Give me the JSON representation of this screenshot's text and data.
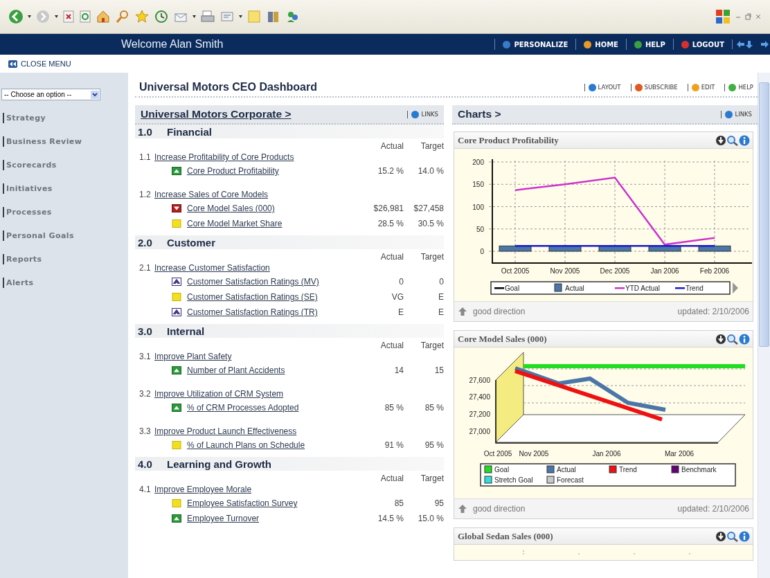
{
  "header": {
    "welcome": "Welcome Alan Smith",
    "nav": [
      {
        "label": "PERSONALIZE",
        "color": "#3a7ac8"
      },
      {
        "label": "HOME",
        "color": "#e89a28"
      },
      {
        "label": "HELP",
        "color": "#3aa040"
      },
      {
        "label": "LOGOUT",
        "color": "#d83030"
      }
    ]
  },
  "close_menu": "CLOSE MENU",
  "sidebar": {
    "select": {
      "value": "-- Choose an option --"
    },
    "items": [
      "Strategy",
      "Business Review",
      "Scorecards",
      "Initiatives",
      "Processes",
      "Personal Goals",
      "Reports",
      "Alerts"
    ]
  },
  "dashboard": {
    "title": "Universal Motors CEO Dashboard",
    "actions": [
      {
        "label": "LAYOUT",
        "color": "#2a7ad0"
      },
      {
        "label": "SUBSCRIBE",
        "color": "#e05a20"
      },
      {
        "label": "EDIT",
        "color": "#f0a020"
      },
      {
        "label": "HELP",
        "color": "#40b040"
      }
    ]
  },
  "scorecard": {
    "title": "Universal Motors Corporate >",
    "links": "LINKS",
    "sections": [
      {
        "number": "1.0",
        "title": "Financial",
        "columns": [
          "Actual",
          "Target"
        ],
        "objectives": [
          {
            "number": "1.1",
            "title": "Increase Profitability of Core Products",
            "measures": [
              {
                "kind": "good",
                "name": "Core Product Profitability",
                "actual": "15.2 %",
                "target": "14.0 %"
              }
            ]
          },
          {
            "number": "1.2",
            "title": "Increase Sales of Core Models",
            "measures": [
              {
                "kind": "bad",
                "name": "Core Model Sales (000)",
                "actual": "$26,981",
                "target": "$27,458"
              },
              {
                "kind": "warning",
                "name": "Core Model Market Share",
                "actual": "28.5 %",
                "target": "30.5 %"
              }
            ]
          }
        ]
      },
      {
        "number": "2.0",
        "title": "Customer",
        "columns": [
          "Actual",
          "Target"
        ],
        "objectives": [
          {
            "number": "2.1",
            "title": "Increase Customer Satisfaction",
            "measures": [
              {
                "kind": "unchanged",
                "name": "Customer Satisfaction Ratings (MV)",
                "actual": "0",
                "target": "0"
              },
              {
                "kind": "warning",
                "name": "Customer Satisfaction Ratings (SE)",
                "actual": "VG",
                "target": "E"
              },
              {
                "kind": "unchanged",
                "name": "Customer Satisfaction Ratings (TR)",
                "actual": "E",
                "target": "E"
              }
            ]
          }
        ]
      },
      {
        "number": "3.0",
        "title": "Internal",
        "columns": [
          "Actual",
          "Target"
        ],
        "objectives": [
          {
            "number": "3.1",
            "title": "Improve Plant Safety",
            "measures": [
              {
                "kind": "good",
                "name": "Number of Plant Accidents",
                "actual": "14",
                "target": "15"
              }
            ]
          },
          {
            "number": "3.2",
            "title": "Improve Utilization of CRM System",
            "measures": [
              {
                "kind": "good",
                "name": "% of CRM Processes Adopted",
                "actual": "85 %",
                "target": "85 %"
              }
            ]
          },
          {
            "number": "3.3",
            "title": "Improve Product Launch Effectiveness",
            "measures": [
              {
                "kind": "warning",
                "name": "% of Launch Plans on Schedule",
                "actual": "91 %",
                "target": "95 %"
              }
            ]
          }
        ]
      },
      {
        "number": "4.0",
        "title": "Learning and Growth",
        "columns": [
          "Actual",
          "Target"
        ],
        "objectives": [
          {
            "number": "4.1",
            "title": "Improve Employee Morale",
            "measures": [
              {
                "kind": "warning",
                "name": "Employee Satisfaction Survey",
                "actual": "85",
                "target": "95"
              },
              {
                "kind": "good",
                "name": "Employee Turnover",
                "actual": "14.5 %",
                "target": "15.0 %"
              }
            ]
          }
        ]
      }
    ]
  },
  "charts_panel": {
    "title": "Charts >",
    "links": "LINKS",
    "cards": [
      {
        "title": "Core Product Profitability",
        "kind": "combo",
        "direction": "good direction",
        "updated": "updated: 2/10/2006",
        "chart_data": {
          "type": "line",
          "grid": true,
          "legend": "bottom",
          "categories": [
            "Oct 2005",
            "Nov 2005",
            "Dec 2005",
            "Jan 2006",
            "Feb 2006"
          ],
          "ylim": [
            0,
            200
          ],
          "yticks": [
            0,
            50,
            100,
            150,
            200
          ],
          "series": [
            {
              "name": "Goal",
              "color": "#000000",
              "type": "line",
              "values": [
                null,
                null,
                null,
                null,
                null
              ]
            },
            {
              "name": "Actual",
              "color": "#4a76a8",
              "type": "bar",
              "values": [
                12,
                12,
                12,
                12,
                12
              ]
            },
            {
              "name": "YTD Actual",
              "color": "#cc33cc",
              "type": "line",
              "values": [
                137,
                150,
                165,
                15,
                30
              ]
            },
            {
              "name": "Trend",
              "color": "#1a1acc",
              "type": "line",
              "values": [
                12,
                12,
                12,
                12,
                12
              ]
            }
          ]
        }
      },
      {
        "title": "Core Model Sales (000)",
        "kind": "perspective",
        "direction": "good direction",
        "updated": "updated: 2/10/2006",
        "picture": {
          "xlabels": [
            "Oct 2005",
            "Nov 2005",
            "Jan 2006",
            "Mar 2006"
          ],
          "ylabels": [
            "27,600",
            "27,400",
            "27,200",
            "27,000"
          ],
          "legend": [
            {
              "name": "Goal",
              "color": "#22dd22"
            },
            {
              "name": "Actual",
              "color": "#4a76a8"
            },
            {
              "name": "Trend",
              "color": "#ee1111"
            },
            {
              "name": "Benchmark",
              "color": "#660077"
            },
            {
              "name": "Stretch Goal",
              "color": "#33dddd"
            },
            {
              "name": "Forecast",
              "color": "#c8c8c8"
            }
          ]
        }
      },
      {
        "title": "Global Sedan Sales (000)",
        "kind": "cut"
      }
    ]
  }
}
